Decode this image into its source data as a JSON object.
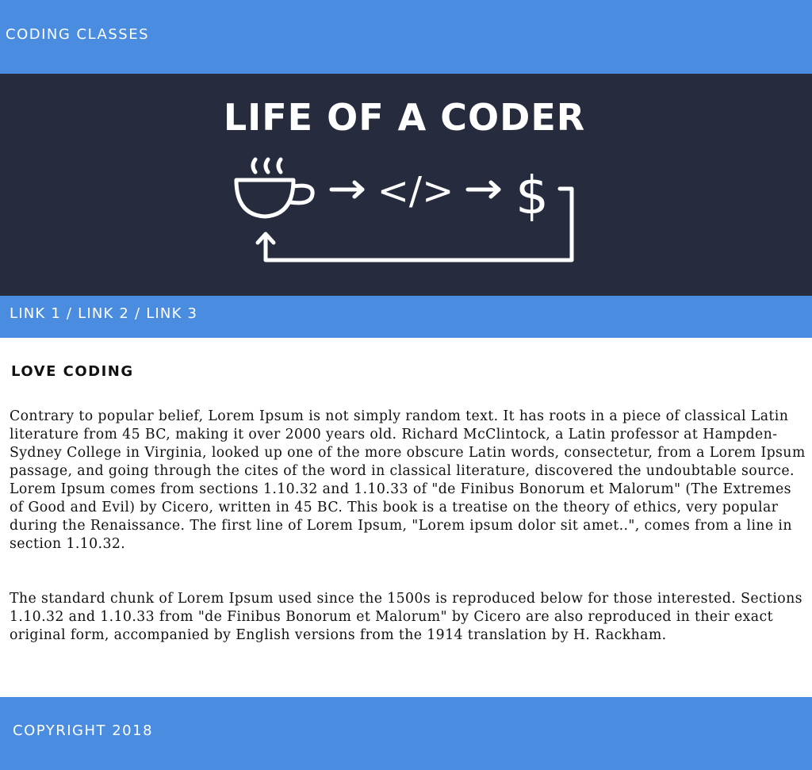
{
  "header": {
    "site_title": "CODING CLASSES"
  },
  "hero": {
    "title": "LIFE OF A CODER",
    "icons": [
      "coffee-cup-icon",
      "arrow-right-icon",
      "code-tag-icon",
      "arrow-right-icon",
      "dollar-icon",
      "loop-back-arrow-icon"
    ],
    "code_symbol": "</>",
    "dollar_symbol": "$"
  },
  "nav": {
    "links": [
      "LINK 1",
      "LINK 2",
      "LINK 3"
    ],
    "separator": "/"
  },
  "main": {
    "heading": "LOVE CODING",
    "paragraphs": [
      "Contrary to popular belief, Lorem Ipsum is not simply random text. It has roots in a piece of classical Latin literature from 45 BC, making it over 2000 years old. Richard McClintock, a Latin professor at Hampden-Sydney College in Virginia, looked up one of the more obscure Latin words, consectetur, from a Lorem Ipsum passage, and going through the cites of the word in classical literature, discovered the undoubtable source. Lorem Ipsum comes from sections 1.10.32 and 1.10.33 of \"de Finibus Bonorum et Malorum\" (The Extremes of Good and Evil) by Cicero, written in 45 BC. This book is a treatise on the theory of ethics, very popular during the Renaissance. The first line of Lorem Ipsum, \"Lorem ipsum dolor sit amet..\", comes from a line in section 1.10.32.",
      "The standard chunk of Lorem Ipsum used since the 1500s is reproduced below for those interested. Sections 1.10.32 and 1.10.33 from \"de Finibus Bonorum et Malorum\" by Cicero are also reproduced in their exact original form, accompanied by English versions from the 1914 translation by H. Rackham."
    ]
  },
  "footer": {
    "copyright": "COPYRIGHT 2018"
  },
  "colors": {
    "accent_blue": "#4a8de0",
    "hero_navy": "#262c3e",
    "text": "#111111",
    "white": "#ffffff"
  }
}
